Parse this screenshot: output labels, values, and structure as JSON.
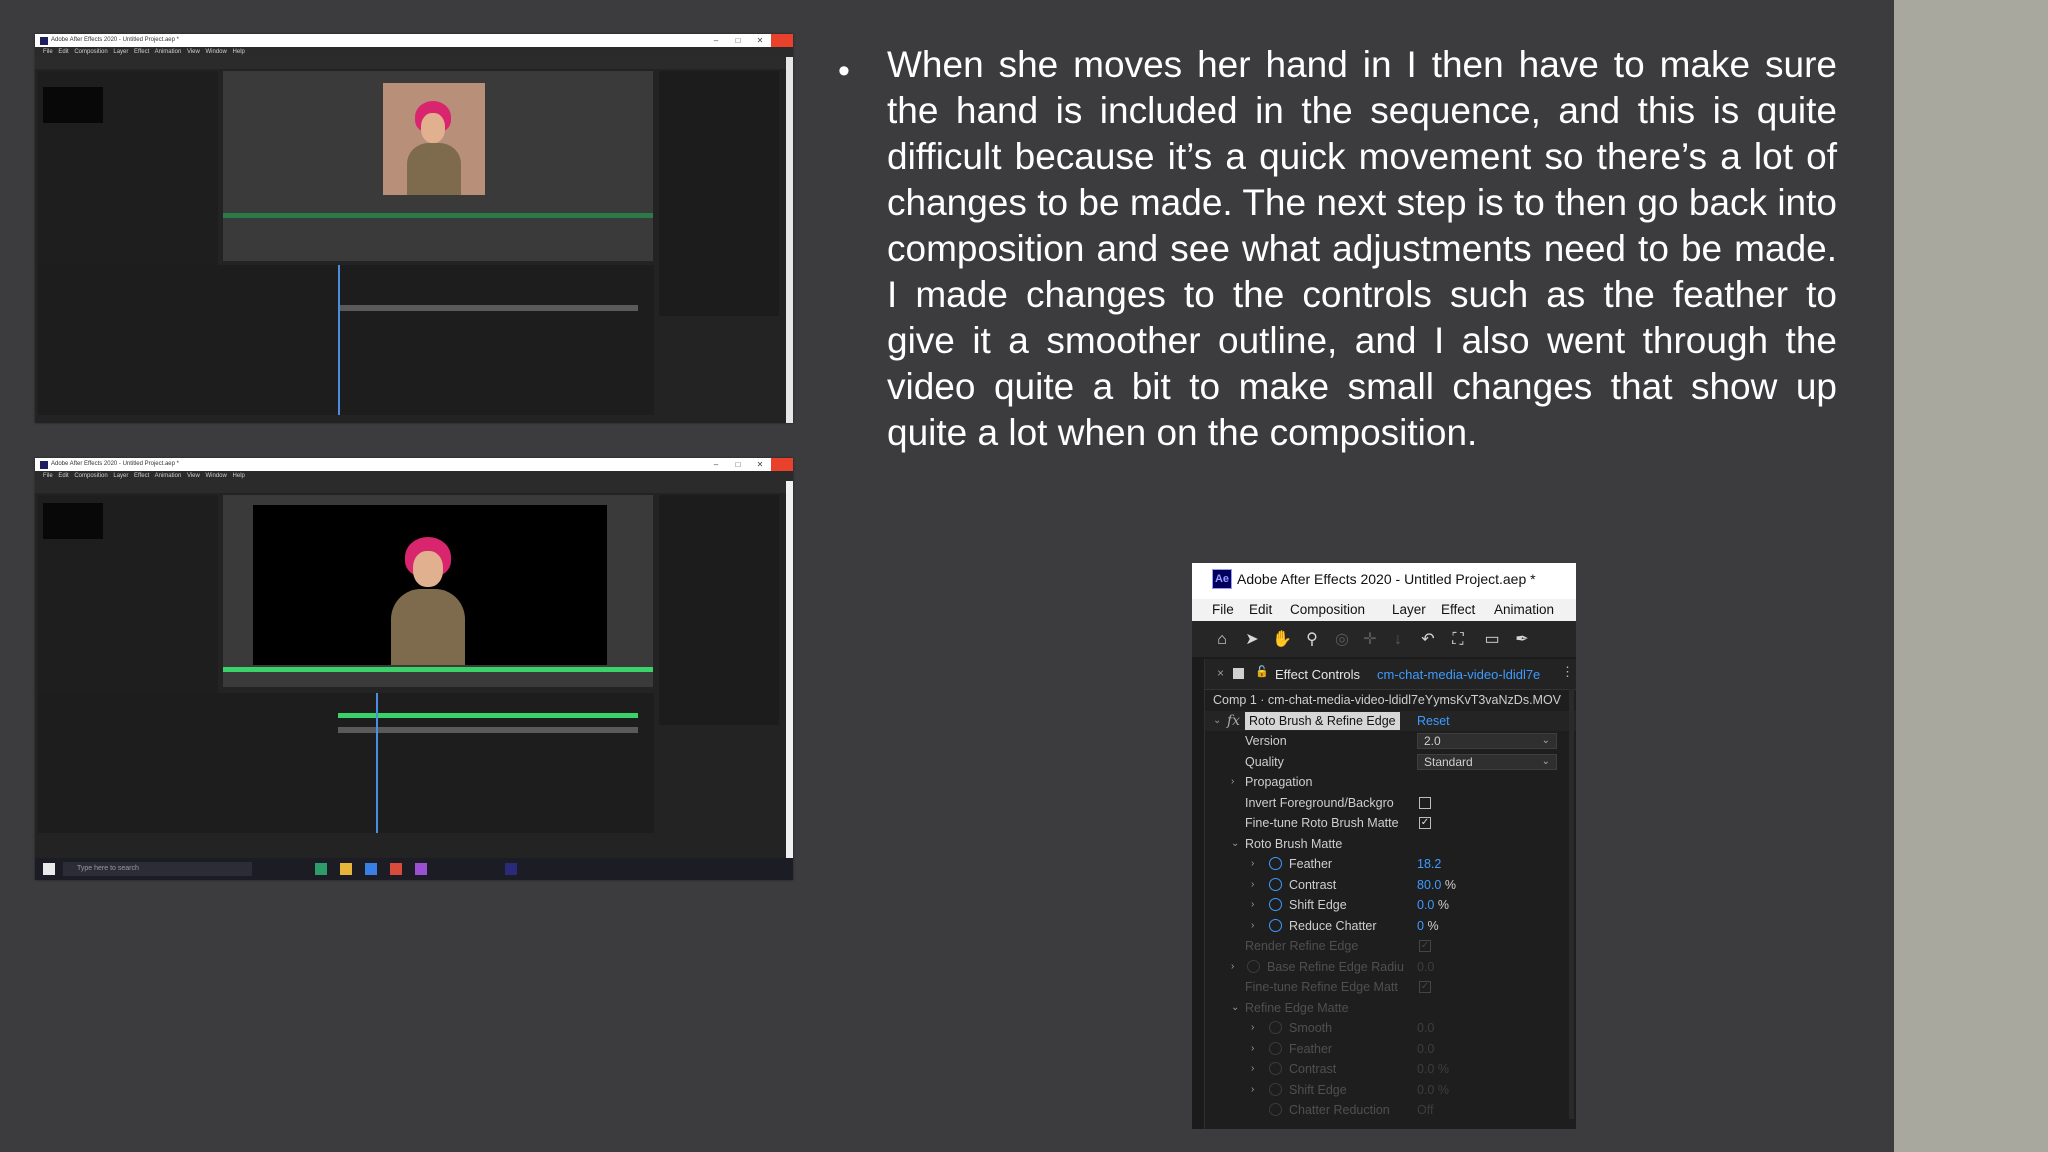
{
  "slide": {
    "bullet": "When she moves her hand in I then have to make sure the hand is included in the sequence, and this is quite difficult because it’s a quick movement so there’s a lot of changes to be made. The next step is to then go back into composition and see what adjustments need to be made. I made changes to the controls such as the feather to give it a smoother outline, and I also went through the video quite a bit  to make small changes that show up quite a lot when on the composition."
  },
  "screenshot_top": {
    "title": "Adobe After Effects 2020 - Untitled Project.aep *",
    "menu": "File  Edit  Composition  Layer  Effect  Animation  View  Window  Help"
  },
  "screenshot_bottom": {
    "title": "Adobe After Effects 2020 - Untitled Project.aep *",
    "menu": "File  Edit  Composition  Layer  Effect  Animation  View  Window  Help",
    "search": "Type here to search"
  },
  "ae_panel": {
    "window_title": "Adobe After Effects 2020 - Untitled Project.aep *",
    "logo": "Ae",
    "menus": [
      "File",
      "Edit",
      "Composition",
      "Layer",
      "Effect",
      "Animation"
    ],
    "tab_label": "Effect Controls",
    "tab_layer": "cm-chat-media-video-ldidl7e",
    "breadcrumb": "Comp 1 · cm-chat-media-video-ldidl7eYymsKvT3vaNzDs.MOV",
    "effect_name": "Roto Brush & Refine Edge",
    "reset": "Reset",
    "version_label": "Version",
    "version_value": "2.0",
    "quality_label": "Quality",
    "quality_value": "Standard",
    "propagation": "Propagation",
    "invert_label": "Invert Foreground/Backgro",
    "finetune_label": "Fine-tune Roto Brush Matte",
    "roto_matte": "Roto Brush Matte",
    "feather_label": "Feather",
    "feather_value": "18.2",
    "contrast_label": "Contrast",
    "contrast_value": "80.0",
    "shift_label": "Shift Edge",
    "shift_value": "0.0",
    "chatter_label": "Reduce Chatter",
    "chatter_value": "0",
    "percent": "%",
    "render_refine": "Render Refine Edge",
    "base_radius": "Base Refine Edge Radiu",
    "base_radius_value": "0.0",
    "finetune_refine": "Fine-tune Refine Edge Matt",
    "refine_matte": "Refine Edge Matte",
    "smooth_label": "Smooth",
    "smooth_value": "0.0",
    "feather2_label": "Feather",
    "feather2_value": "0.0",
    "contrast2_label": "Contrast",
    "contrast2_value": "0.0",
    "shift2_label": "Shift Edge",
    "shift2_value": "0.0",
    "chatter2_label": "Chatter Reduction",
    "chatter2_value": "Off"
  }
}
